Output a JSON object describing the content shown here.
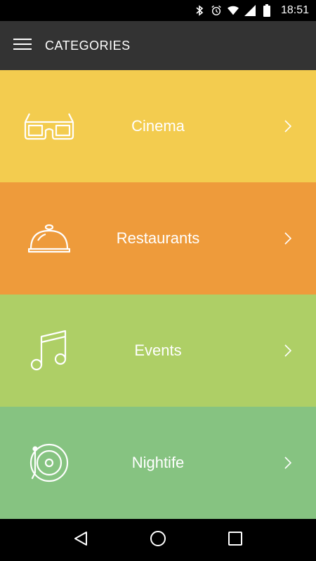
{
  "status_bar": {
    "time": "18:51",
    "icons": [
      "bluetooth-icon",
      "alarm-icon",
      "wifi-icon",
      "cellular-icon",
      "battery-icon"
    ]
  },
  "app_bar": {
    "title": "CATEGORIES",
    "menu_icon": "hamburger-menu-icon"
  },
  "categories": [
    {
      "label": "Cinema",
      "icon": "3d-glasses-icon",
      "color": "#F3CC4F"
    },
    {
      "label": "Restaurants",
      "icon": "food-cloche-icon",
      "color": "#EE9B3B"
    },
    {
      "label": "Events",
      "icon": "music-note-icon",
      "color": "#AECF66"
    },
    {
      "label": "Nightife",
      "icon": "vinyl-record-icon",
      "color": "#86C381"
    }
  ],
  "nav_bar": {
    "buttons": [
      "back-icon",
      "home-icon",
      "recents-icon"
    ]
  },
  "colors": {
    "status_bar": "#000000",
    "app_bar": "#333333",
    "nav_bar": "#000000"
  }
}
